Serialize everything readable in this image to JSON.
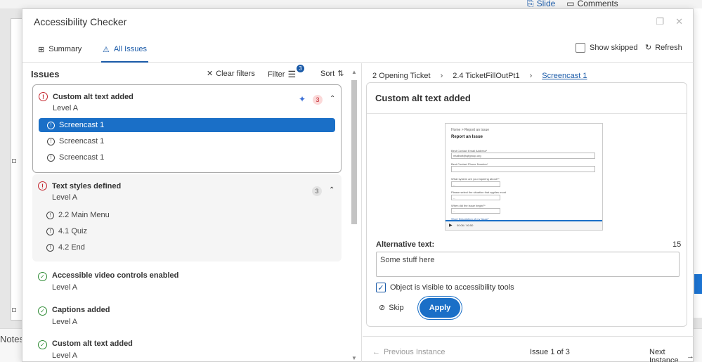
{
  "background": {
    "ribbon_tabs": [
      "Slide",
      "Comments"
    ],
    "notes_label": "Notes"
  },
  "dialog": {
    "title": "Accessibility Checker",
    "tabs": [
      {
        "label": "Summary"
      },
      {
        "label": "All Issues"
      }
    ],
    "show_skipped_label": "Show skipped",
    "refresh_label": "Refresh"
  },
  "issues_panel": {
    "heading": "Issues",
    "clear_filters_label": "Clear filters",
    "filter_label": "Filter",
    "filter_count": "3",
    "sort_label": "Sort",
    "groups": [
      {
        "title": "Custom alt text added",
        "level": "Level A",
        "count": "3",
        "items": [
          "Screencast 1",
          "Screencast 1",
          "Screencast 1"
        ]
      },
      {
        "title": "Text styles defined",
        "level": "Level A",
        "count": "3",
        "items": [
          "2.2 Main Menu",
          "4.1 Quiz",
          "4.2 End"
        ]
      }
    ],
    "passed": [
      {
        "title": "Accessible video controls enabled",
        "level": "Level A"
      },
      {
        "title": "Captions added",
        "level": "Level A"
      },
      {
        "title": "Custom alt text added",
        "level": "Level A"
      }
    ]
  },
  "detail": {
    "breadcrumb": [
      "2 Opening Ticket",
      "2.4 TicketFillOutPt1",
      "Screencast 1"
    ],
    "card_title": "Custom alt text added",
    "preview": {
      "crumb": "Home  >  Report an issue",
      "title": "Report an Issue",
      "email_label": "Best Contact Email Address*",
      "email_value": "mtalbott@ajfgroup.org",
      "phone_label": "Best Contact Phone Number*",
      "system_label": "What system are you inquiring about?*",
      "situation_label": "Please select the situation that applies most",
      "when_label": "When did the issue begin?*",
      "desc_label": "Short Description of my Issue*",
      "select_placeholder": "--",
      "time": "00:06 / 00:50"
    },
    "alt_text_label": "Alternative text:",
    "alt_text_count": "15",
    "alt_text_value": "Some stuff here",
    "visible_label": "Object is visible to accessibility tools",
    "skip_label": "Skip",
    "apply_label": "Apply",
    "prev_label": "Previous Instance",
    "position_label": "Issue 1 of 3",
    "next_label": "Next Instance"
  }
}
